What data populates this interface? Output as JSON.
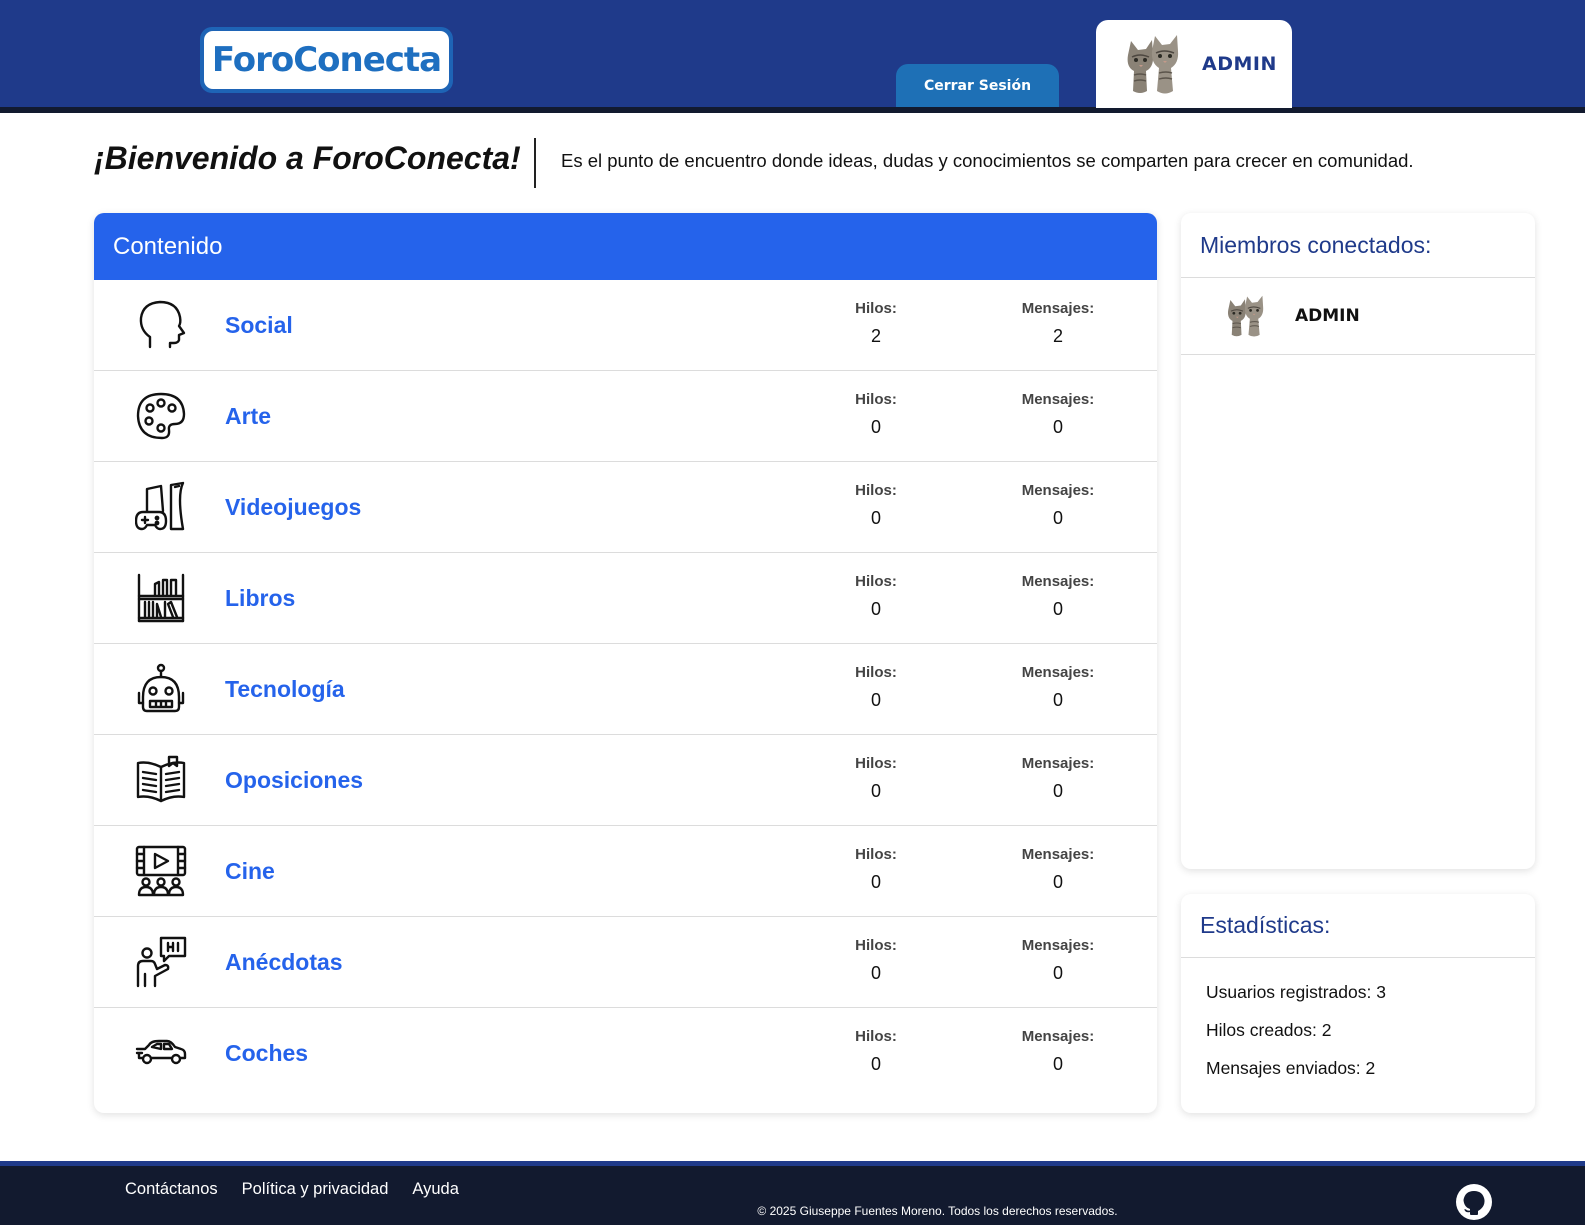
{
  "header": {
    "logo_text": "ForoConecta",
    "logout_label": "Cerrar Sesión",
    "user_name": "ADMIN"
  },
  "welcome": {
    "title": "¡Bienvenido a ForoConecta!",
    "text": "Es el punto de encuentro donde ideas, dudas y conocimientos se comparten para crecer en comunidad."
  },
  "content": {
    "title": "Contenido",
    "categories": [
      {
        "name": "Social",
        "icon": "head-profile-icon",
        "hilos_label": "Hilos:",
        "hilos": "2",
        "mensajes_label": "Mensajes:",
        "mensajes": "2"
      },
      {
        "name": "Arte",
        "icon": "palette-icon",
        "hilos_label": "Hilos:",
        "hilos": "0",
        "mensajes_label": "Mensajes:",
        "mensajes": "0"
      },
      {
        "name": "Videojuegos",
        "icon": "gamepad-console-icon",
        "hilos_label": "Hilos:",
        "hilos": "0",
        "mensajes_label": "Mensajes:",
        "mensajes": "0"
      },
      {
        "name": "Libros",
        "icon": "bookshelf-icon",
        "hilos_label": "Hilos:",
        "hilos": "0",
        "mensajes_label": "Mensajes:",
        "mensajes": "0"
      },
      {
        "name": "Tecnología",
        "icon": "robot-icon",
        "hilos_label": "Hilos:",
        "hilos": "0",
        "mensajes_label": "Mensajes:",
        "mensajes": "0"
      },
      {
        "name": "Oposiciones",
        "icon": "open-book-icon",
        "hilos_label": "Hilos:",
        "hilos": "0",
        "mensajes_label": "Mensajes:",
        "mensajes": "0"
      },
      {
        "name": "Cine",
        "icon": "cinema-audience-icon",
        "hilos_label": "Hilos:",
        "hilos": "0",
        "mensajes_label": "Mensajes:",
        "mensajes": "0"
      },
      {
        "name": "Anécdotas",
        "icon": "speaker-hi-icon",
        "hilos_label": "Hilos:",
        "hilos": "0",
        "mensajes_label": "Mensajes:",
        "mensajes": "0"
      },
      {
        "name": "Coches",
        "icon": "car-icon",
        "hilos_label": "Hilos:",
        "hilos": "0",
        "mensajes_label": "Mensajes:",
        "mensajes": "0"
      }
    ]
  },
  "members": {
    "title": "Miembros conectados:",
    "list": [
      {
        "name": "ADMIN"
      }
    ]
  },
  "stats": {
    "title": "Estadísticas:",
    "usuarios": "Usuarios registrados: 3",
    "hilos": "Hilos creados: 2",
    "mensajes": "Mensajes enviados: 2"
  },
  "footer": {
    "links": [
      "Contáctanos",
      "Política y privacidad",
      "Ayuda"
    ],
    "copyright": "© 2025 Giuseppe Fuentes Moreno. Todos los derechos reservados."
  },
  "colors": {
    "header_bg": "#1f3a8a",
    "accent_blue": "#2563eb",
    "footer_bg": "#121a2f",
    "logout_bg": "#1e70b6"
  }
}
